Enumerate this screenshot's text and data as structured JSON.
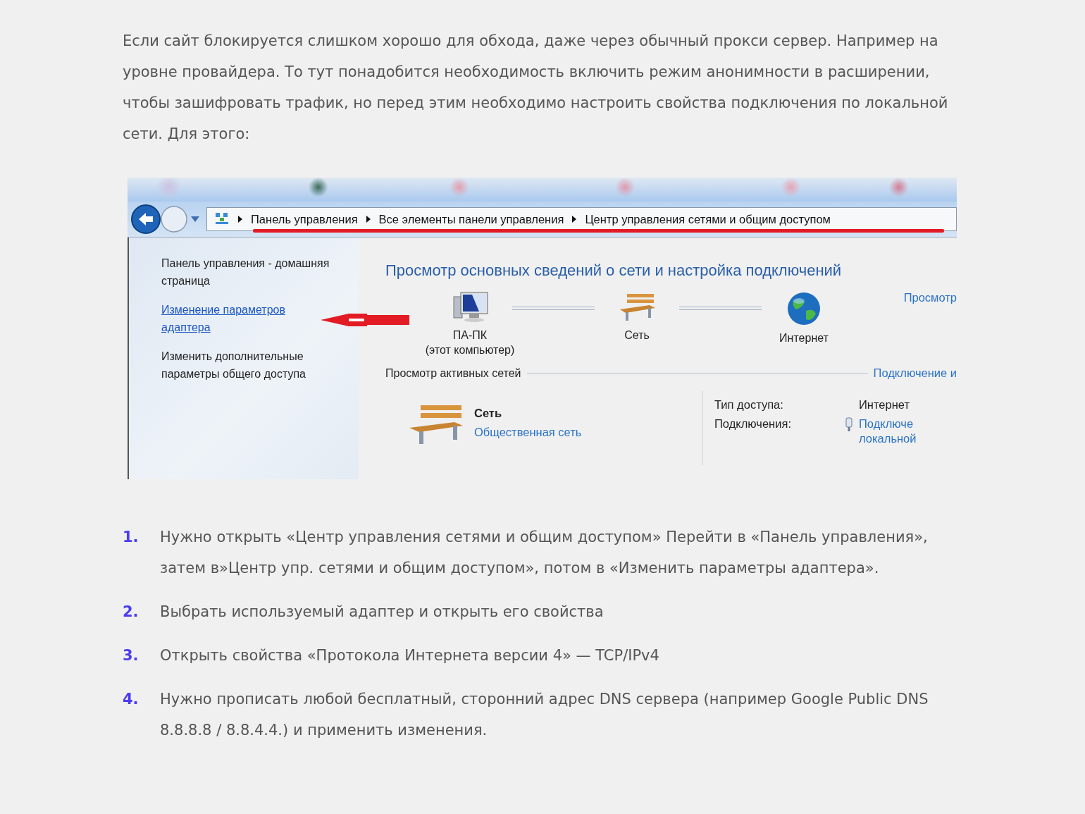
{
  "intro": "Если сайт блокируется слишком хорошо для обхода, даже через обычный прокси сервер. Например на уровне провайдера. То тут понадобится необходимость включить режим анонимности в расширении, чтобы зашифровать трафик, но перед этим необходимо настроить свойства подключения по локальной сети. Для этого:",
  "screenshot": {
    "breadcrumbs": [
      "Панель управления",
      "Все элементы панели управления",
      "Центр управления сетями и общим доступом"
    ],
    "sidebar": [
      {
        "text": "Панель управления - домашняя страница",
        "kind": "text"
      },
      {
        "text": "Изменение параметров адаптера",
        "kind": "link"
      },
      {
        "text": "Изменить дополнительные параметры общего доступа",
        "kind": "text"
      }
    ],
    "heading": "Просмотр основных сведений о сети и настройка подключений",
    "network_map": [
      {
        "kind": "computer",
        "label": "ПА-ПК",
        "sublabel": "(этот компьютер)"
      },
      {
        "kind": "bench",
        "label": "Сеть"
      },
      {
        "kind": "globe",
        "label": "Интернет"
      }
    ],
    "map_link": "Просмотр",
    "active_label": "Просмотр активных сетей",
    "active_link": "Подключение и",
    "network": {
      "name": "Сеть",
      "type": "Общественная сеть"
    },
    "details": [
      {
        "label": "Тип доступа:",
        "kind": "text",
        "value_lines": [
          "Интернет"
        ]
      },
      {
        "label": "Подключения:",
        "kind": "link",
        "value_lines": [
          "Подключе",
          "локальной"
        ]
      }
    ]
  },
  "steps": [
    {
      "number": "1.",
      "text": "Нужно открыть «Центр управления сетями и общим доступом» Перейти в «Панель управления», затем в»Центр упр. сетями и общим доступом», потом в «Изменить параметры адаптера»."
    },
    {
      "number": "2.",
      "text": "Выбрать используемый адаптер и открыть его свойства"
    },
    {
      "number": "3.",
      "text": "Открыть свойства «Протокола Интернета версии 4» — TCP/IPv4"
    },
    {
      "number": "4.",
      "text": "Нужно прописать любой бесплатный, сторонний адрес DNS сервера (например Google Public DNS 8.8.8.8 / 8.8.4.4.) и применить изменения."
    }
  ]
}
